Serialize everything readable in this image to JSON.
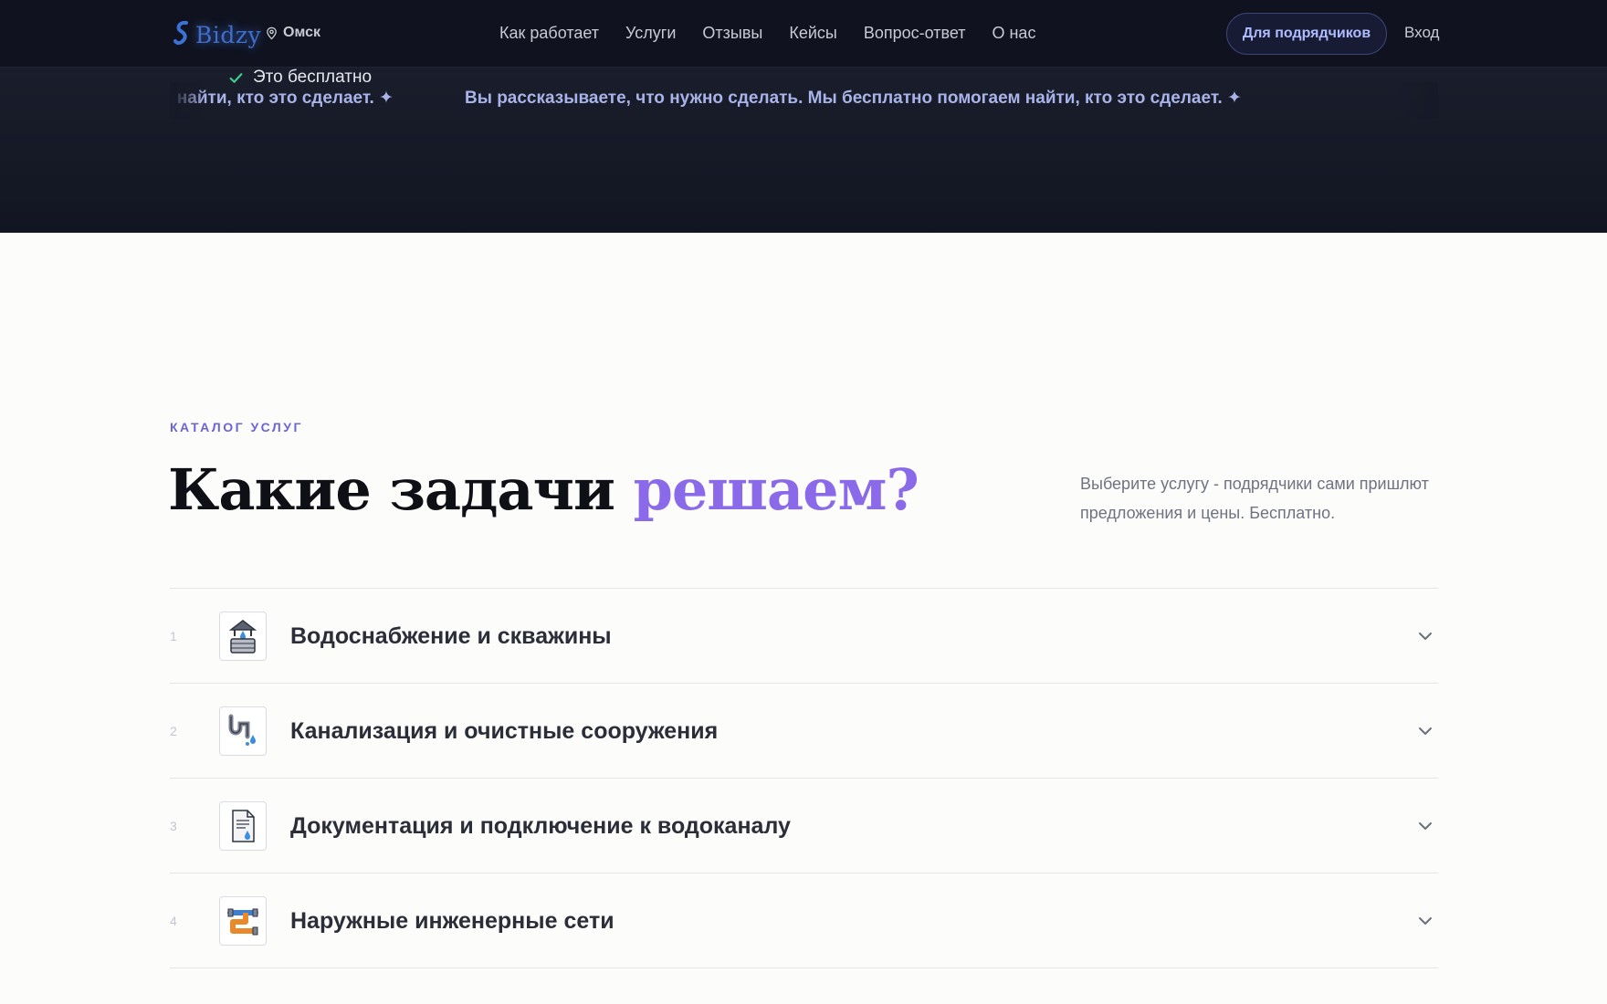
{
  "header": {
    "logo_text": "Bidzy",
    "city": "Омск",
    "nav": [
      "Как работает",
      "Услуги",
      "Отзывы",
      "Кейсы",
      "Вопрос-ответ",
      "О нас"
    ],
    "contractors_button": "Для подрядчиков",
    "login": "Вход"
  },
  "hero": {
    "free_note": "Это бесплатно",
    "marquee": [
      "Вы рассказываете, что нужно сделать. Мы бесплатно помогаем найти, кто это сделает. ✦",
      "Вы рассказываете, что нужно сделать. Мы бесплатно помогаем найти, кто это сделает. ✦"
    ]
  },
  "catalog": {
    "eyebrow": "КАТАЛОГ УСЛУГ",
    "title_main": "Какие задачи",
    "title_accent": "решаем?",
    "lead": "Выберите услугу - подрядчики сами пришлют предложения и цены. Бесплатно.",
    "items": [
      {
        "num": "1",
        "title": "Водоснабжение и скважины",
        "icon": "well-icon"
      },
      {
        "num": "2",
        "title": "Канализация и очистные сооружения",
        "icon": "pipe-icon"
      },
      {
        "num": "3",
        "title": "Документация и подключение к водоканалу",
        "icon": "document-icon"
      },
      {
        "num": "4",
        "title": "Наружные инженерные сети",
        "icon": "network-pipes-icon"
      }
    ]
  },
  "colors": {
    "header_bg": "#10131f",
    "accent": "#8b6ae9",
    "eyebrow": "#6a64d8",
    "marquee_text": "#a8b3e8",
    "check_green": "#3ecf8e"
  }
}
